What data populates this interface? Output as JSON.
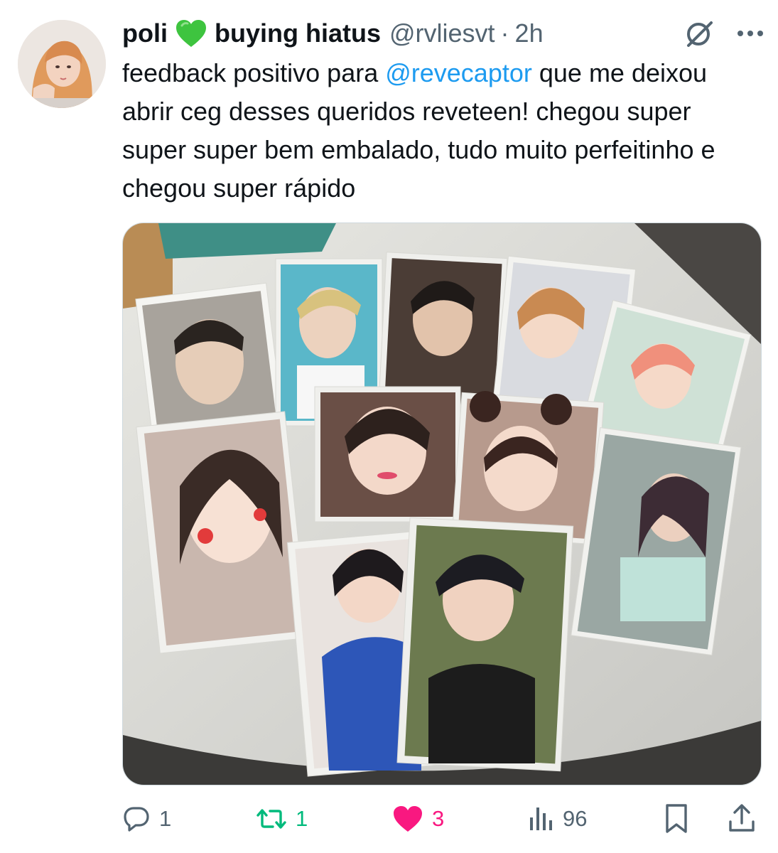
{
  "tweet": {
    "author": {
      "display_name_prefix": "poli",
      "heart_emoji": "green-heart",
      "display_name_suffix": "buying hiatus",
      "handle": "@rvliesvt",
      "separator": "·",
      "time": "2h"
    },
    "text": {
      "part1": "feedback positivo para ",
      "mention": "@revecaptor",
      "part2": " que me deixou abrir ceg desses queridos reveteen! chegou super super super bem embalado, tudo muito perfeitinho e chegou super rápido"
    },
    "media": {
      "description_icon": "photo"
    },
    "actions": {
      "reply_count": "1",
      "retweet_count": "1",
      "like_count": "3",
      "views_count": "96"
    }
  },
  "colors": {
    "text": "#0f1419",
    "secondary": "#536471",
    "link": "#1d9bf0",
    "retweet": "#00ba7c",
    "like": "#f91880"
  }
}
